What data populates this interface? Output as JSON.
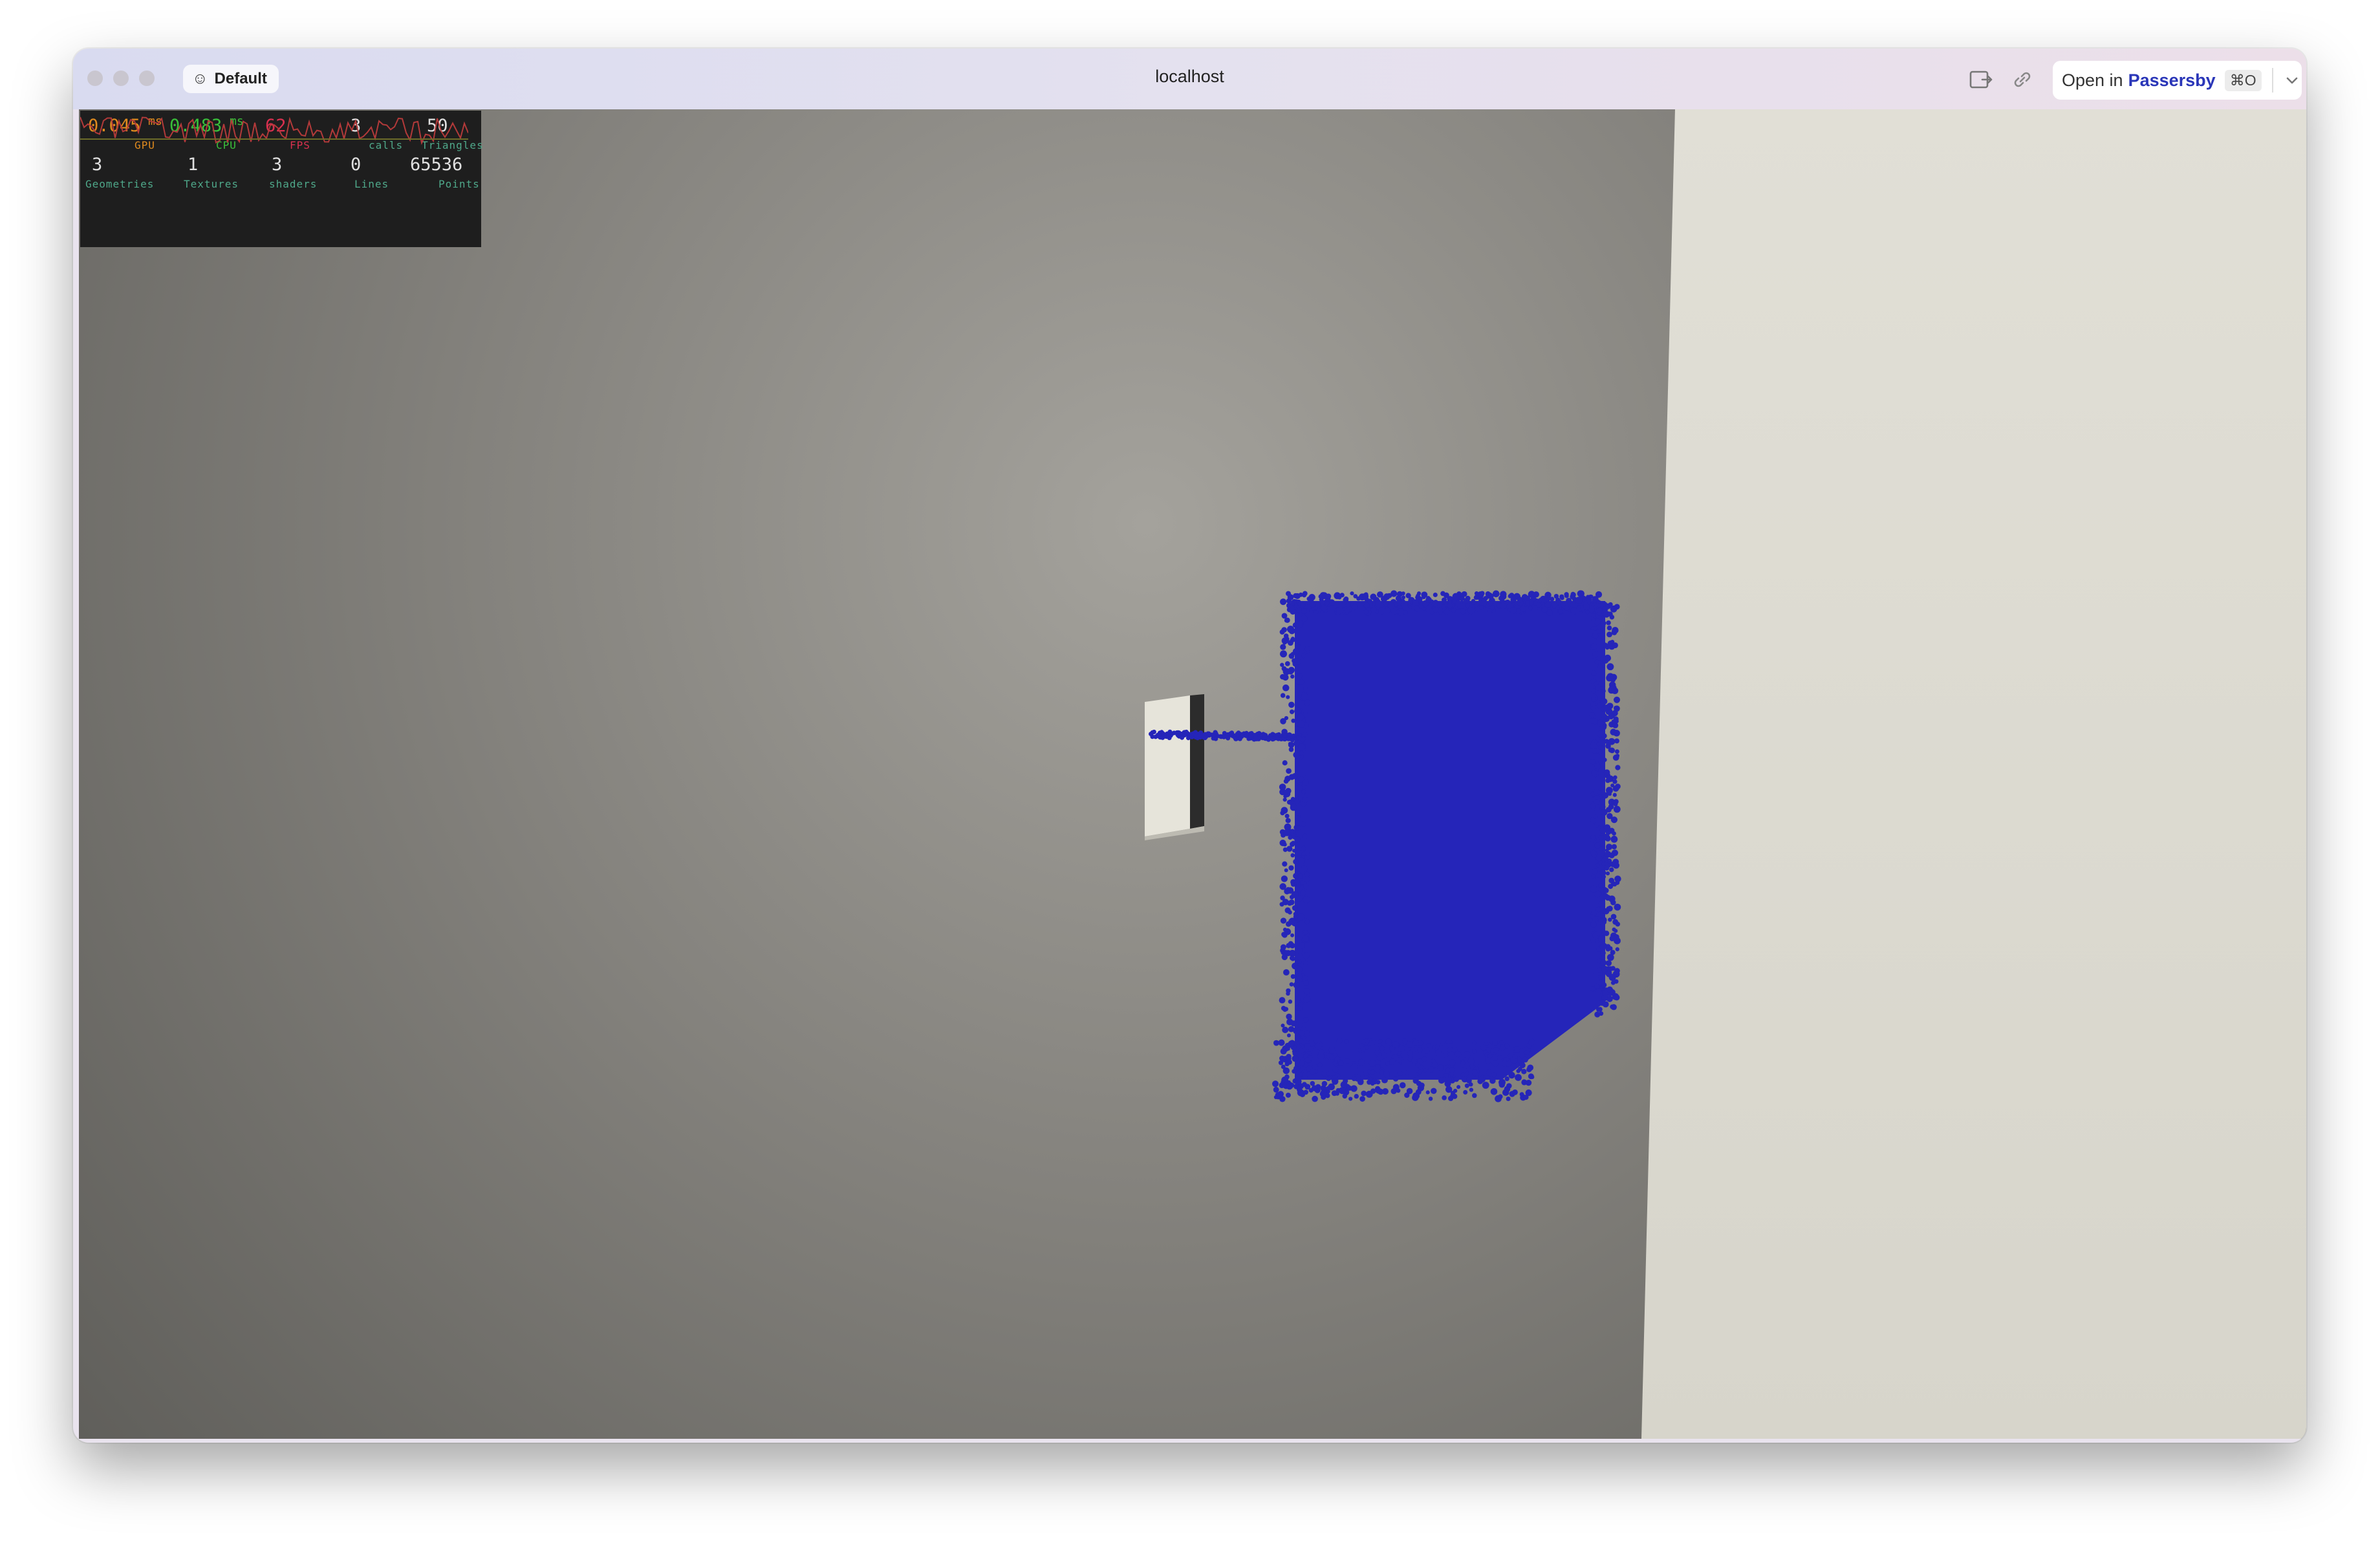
{
  "window": {
    "profile_label": "Default",
    "url": "localhost",
    "open_in": {
      "prefix": "Open in",
      "app": "Passersby",
      "shortcut": "⌘O"
    }
  },
  "stats": {
    "gpu": {
      "value": "0.045",
      "unit": "ms",
      "label": "GPU",
      "color": "#e08a1e"
    },
    "cpu": {
      "value": "0.483",
      "unit": "ms",
      "label": "CPU",
      "color": "#39c03a"
    },
    "fps": {
      "value": "62",
      "label": "FPS",
      "color": "#d9304f"
    },
    "calls": {
      "value": "3",
      "label": "calls"
    },
    "triangles": {
      "value": "50",
      "label": "Triangles"
    },
    "geometries": {
      "value": "3",
      "label": "Geometries"
    },
    "textures": {
      "value": "1",
      "label": "Textures"
    },
    "shaders": {
      "value": "3",
      "label": "shaders"
    },
    "lines": {
      "value": "0",
      "label": "Lines"
    },
    "points": {
      "value": "65536",
      "label": "Points"
    },
    "label_color": "#4fa88a"
  },
  "scene": {
    "particle_color": "#2525b9",
    "wall_color": "#dedcd2",
    "floor_color": "#85837d"
  }
}
